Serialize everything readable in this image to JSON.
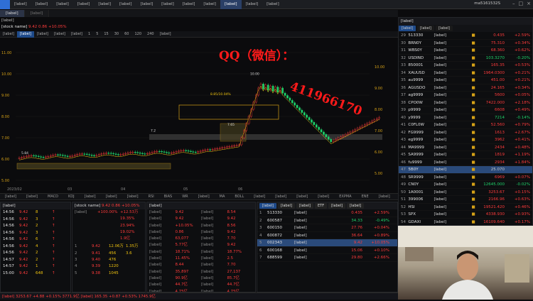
{
  "top_nav": {
    "items": [
      "[label]",
      "[label]",
      "[label]",
      "[label]",
      "[label]",
      "[label]",
      "[label]",
      "[label]",
      "[label]",
      "[label]",
      "[label]",
      "[label]",
      "[label]"
    ],
    "active_index": 10,
    "user": "ma5161532S"
  },
  "doc_tabs": [
    "[label]",
    "[label]"
  ],
  "sub_title": "[label]",
  "stock_header": {
    "name": "[stock name]",
    "price": "9.42",
    "change": "0.86",
    "pct": "+10.05%"
  },
  "periods": [
    "[label]",
    "[label]",
    "[label]",
    "[label]",
    "[label]",
    "1",
    "5",
    "15",
    "30",
    "60",
    "120",
    "240",
    "[label]"
  ],
  "period_active": 1,
  "chart_data": {
    "type": "candlestick",
    "y_ticks": [
      "11.00",
      "10.00",
      "9.00",
      "8.00",
      "7.00",
      "6.00",
      "5.00"
    ],
    "right_ticks": [
      "10.00",
      "9.00",
      "8.00",
      "7.00",
      "6.00",
      "5.00"
    ],
    "x_ticks": [
      "2023/02",
      "03",
      "04",
      "05",
      "06"
    ],
    "labels": {
      "low": "5.84",
      "marker_a": "7.2",
      "box": "8.85/10.04%",
      "mid": "7.65",
      "hi": "10.00"
    }
  },
  "indicators": [
    "[label]",
    "[label]",
    "MACD",
    "KDJ",
    "[label]",
    "[label]",
    "[label]",
    "RSI",
    "BIAS",
    "WR",
    "[label]",
    "MA",
    "BOLL",
    "[label]",
    "[label]",
    "[label]",
    "[label]",
    "EXPMA",
    "ENE",
    "[label]"
  ],
  "trades": {
    "header": "[label]",
    "rows": [
      [
        "14:56",
        "9.42",
        "8",
        "↑"
      ],
      [
        "14:56",
        "9.42",
        "3",
        "↑"
      ],
      [
        "14:56",
        "9.42",
        "2",
        "↑"
      ],
      [
        "14:56",
        "9.42",
        "3",
        "↑"
      ],
      [
        "14:56",
        "9.42",
        "6",
        "↑"
      ],
      [
        "14:56",
        "9.42",
        "4",
        "↑"
      ],
      [
        "14:56",
        "9.42",
        "2",
        "↑"
      ],
      [
        "14:57",
        "9.42",
        "2",
        "↑"
      ],
      [
        "14:57",
        "9.42",
        "1",
        "↑"
      ],
      [
        "15:00",
        "9.42",
        "648",
        "↑"
      ]
    ]
  },
  "book": {
    "header": "[label]",
    "title": "[stock name]",
    "sub": "9.42  0.86  +10.05%",
    "rows": [
      [
        "[label]",
        "+100.00%",
        "+12.53万"
      ],
      [
        "",
        "",
        "19.35%"
      ],
      [
        "",
        "",
        "23.94%"
      ],
      [
        "",
        "",
        "19.02%"
      ],
      [
        "",
        "",
        "1.9亿"
      ]
    ],
    "levels": [
      [
        "1",
        "9.42",
        "12.06万",
        "1.35万"
      ],
      [
        "2",
        "9.41",
        "456",
        "3.6"
      ],
      [
        "3",
        "9.40",
        "476",
        ""
      ],
      [
        "4",
        "9.39",
        "1220",
        ""
      ],
      [
        "5",
        "9.38",
        "1045",
        ""
      ]
    ]
  },
  "quote": {
    "header": "[label]",
    "rows": [
      [
        "[label]",
        "9.42",
        "[label]",
        "8.54"
      ],
      [
        "[label]",
        "9.42",
        "[label]",
        "9.42"
      ],
      [
        "[label]",
        "+10.05%",
        "[label]",
        "8.56"
      ],
      [
        "[label]",
        "0.86",
        "[label]",
        "9.42"
      ],
      [
        "[label]",
        "63,077",
        "[label]",
        "7.70"
      ],
      [
        "[label]",
        "5.77亿",
        "[label]",
        "9.42"
      ],
      [
        "[label]",
        "18.71%",
        "[label]",
        "18.77%"
      ],
      [
        "[label]",
        "11.45%",
        "[label]",
        "2.5"
      ],
      [
        "[label]",
        "8.44",
        "[label]",
        "7.70"
      ],
      [
        "[label]",
        "35,897",
        "[label]",
        "27,137"
      ],
      [
        "[label]",
        "90.9亿",
        "[label]",
        "85.7亿"
      ],
      [
        "[label]",
        "44.7亿",
        "[label]",
        "44.7亿"
      ],
      [
        "[label]",
        "4.75亿",
        "[label]",
        "4.75亿"
      ]
    ]
  },
  "watch2": {
    "tabs": [
      "[label]",
      "[label]",
      "[label]",
      "ETF",
      "[label]",
      "[label]"
    ],
    "rows": [
      [
        "1",
        "513330",
        "[label]",
        "0.435",
        "+2.59%"
      ],
      [
        "2",
        "600587",
        "[label]",
        "34.33",
        "-0.49%"
      ],
      [
        "3",
        "600150",
        "[label]",
        "27.76",
        "+0.04%"
      ],
      [
        "4",
        "600872",
        "[label]",
        "36.64",
        "+0.89%"
      ],
      [
        "5",
        "002343",
        "[label]",
        "9.42",
        "+10.05%"
      ],
      [
        "6",
        "600168",
        "[label]",
        "15.06",
        "+0.10%"
      ],
      [
        "7",
        "688599",
        "[label]",
        "29.80",
        "+2.66%"
      ]
    ]
  },
  "watchlist": {
    "header": "[label]",
    "tabs": [
      "[label]",
      "[label]",
      "[label]"
    ],
    "rows": [
      [
        "29",
        "513330",
        "[label]",
        "0.435",
        "+2.59%"
      ],
      [
        "30",
        "BRN0Y",
        "[label]",
        "75.310",
        "+0.34%"
      ],
      [
        "31",
        "WBS0Y",
        "[label]",
        "68.360",
        "+0.62%"
      ],
      [
        "32",
        "USDIND",
        "[label]",
        "103.3270",
        "-0.20%"
      ],
      [
        "33",
        "850001",
        "[label]",
        "165.35",
        "+0.53%"
      ],
      [
        "34",
        "XAUUSD",
        "[label]",
        "1964.0300",
        "+0.21%"
      ],
      [
        "35",
        "au9999",
        "[label]",
        "451.00",
        "+0.21%"
      ],
      [
        "36",
        "AGUSDO",
        "[label]",
        "24.165",
        "+0.34%"
      ],
      [
        "37",
        "ag9999",
        "[label]",
        "5600",
        "+0.05%"
      ],
      [
        "38",
        "CPO0W",
        "[label]",
        "7422.000",
        "+2.18%"
      ],
      [
        "39",
        "p9999",
        "[label]",
        "6608",
        "+0.49%"
      ],
      [
        "40",
        "y9999",
        "[label]",
        "7214",
        "-0.14%"
      ],
      [
        "41",
        "C0FL0W",
        "[label]",
        "52.560",
        "+0.79%"
      ],
      [
        "42",
        "FG9999",
        "[label]",
        "1613",
        "+2.67%"
      ],
      [
        "43",
        "eg9999",
        "[label]",
        "3962",
        "+0.41%"
      ],
      [
        "44",
        "MA9999",
        "[label]",
        "2434",
        "+0.48%"
      ],
      [
        "45",
        "SA9999",
        "[label]",
        "1819",
        "+1.19%"
      ],
      [
        "46",
        "fu9999",
        "[label]",
        "2934",
        "+1.84%"
      ],
      [
        "47",
        "5B0Y",
        "[label]",
        "25.070",
        ""
      ],
      [
        "48",
        "SR9999",
        "[label]",
        "6969",
        "+0.07%"
      ],
      [
        "49",
        "CN0Y",
        "[label]",
        "12645.000",
        "-0.02%"
      ],
      [
        "50",
        "1A0001",
        "[label]",
        "3253.67",
        "+0.15%"
      ],
      [
        "51",
        "399006",
        "[label]",
        "2166.96",
        "+0.63%"
      ],
      [
        "52",
        "HSI",
        "[label]",
        "19521.420",
        "+0.46%"
      ],
      [
        "53",
        "SPX",
        "[label]",
        "4338.930",
        "+0.93%"
      ],
      [
        "54",
        "GDAXI",
        "[label]",
        "16109.640",
        "+0.17%"
      ]
    ]
  },
  "ticker": {
    "text": "[label]  3253.67 +4.88 +0.15%  3771.9亿   [label]  165.35 +0.87 +0.53%  1745.9亿"
  },
  "watermark": {
    "line1": "QQ（微信）：",
    "line2": "411966170"
  },
  "colors": {
    "up": "#ff3b3b",
    "down": "#1fd36a",
    "accent": "#2f6fd6",
    "highlight": "#f1c40f",
    "watermark": "#ff1a1a"
  }
}
